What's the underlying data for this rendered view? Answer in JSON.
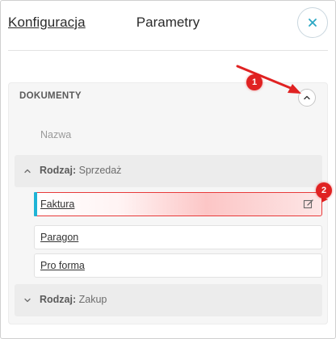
{
  "header": {
    "back_link": "Konfiguracja",
    "title": "Parametry",
    "close_icon": "close-icon"
  },
  "section": {
    "title": "DOKUMENTY",
    "collapse_icon": "chevron-up-icon",
    "column_header": "Nazwa"
  },
  "groups": [
    {
      "key": "Rodzaj:",
      "value": "Sprzedaż",
      "expanded": true
    },
    {
      "key": "Rodzaj:",
      "value": "Zakup",
      "expanded": false
    }
  ],
  "documents": [
    {
      "label": "Faktura",
      "selected": true
    },
    {
      "label": "Paragon",
      "selected": false
    },
    {
      "label": "Pro forma",
      "selected": false
    }
  ],
  "annotations": {
    "badge_1": "1",
    "badge_2": "2"
  },
  "colors": {
    "accent_bar": "#1fb4d6",
    "annotation_red": "#e02222",
    "close_icon": "#2aa7c4"
  }
}
